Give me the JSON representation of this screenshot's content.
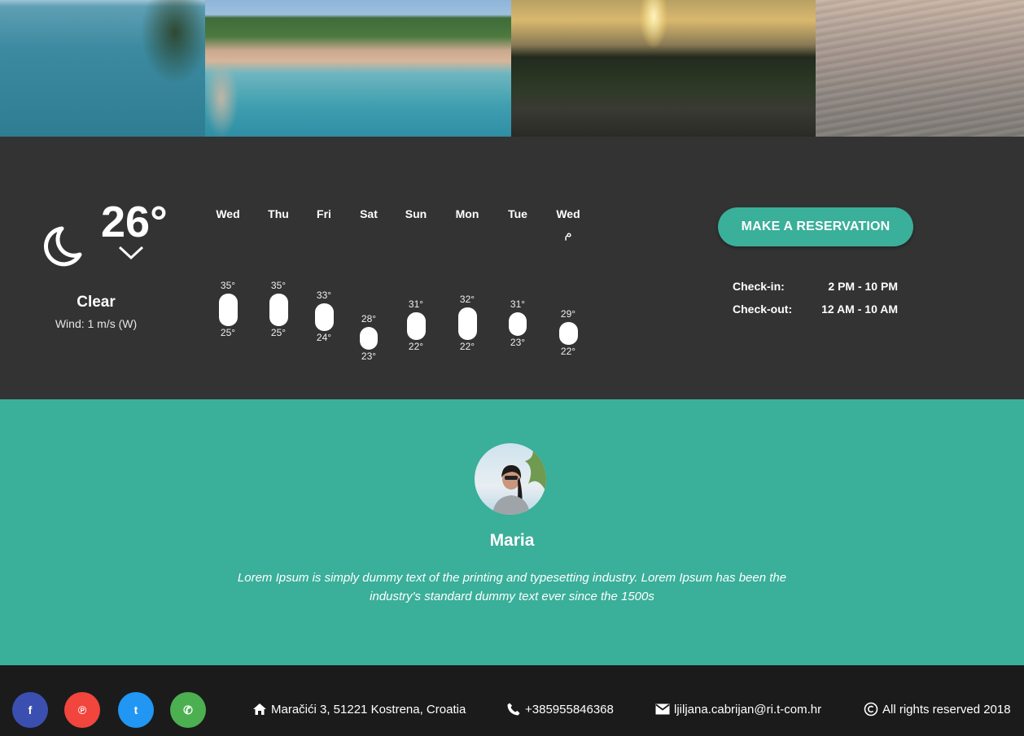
{
  "weather": {
    "current_temp": "26°",
    "condition": "Clear",
    "wind": "Wind: 1 m/s (W)",
    "icon": "moon-icon",
    "forecast": [
      {
        "day": "Wed",
        "high": "35°",
        "low": "25°",
        "high_val": 35,
        "low_val": 25
      },
      {
        "day": "Thu",
        "high": "35°",
        "low": "25°",
        "high_val": 35,
        "low_val": 25
      },
      {
        "day": "Fri",
        "high": "33°",
        "low": "24°",
        "high_val": 33,
        "low_val": 24
      },
      {
        "day": "Sat",
        "high": "28°",
        "low": "23°",
        "high_val": 28,
        "low_val": 23
      },
      {
        "day": "Sun",
        "high": "31°",
        "low": "22°",
        "high_val": 31,
        "low_val": 22
      },
      {
        "day": "Mon",
        "high": "32°",
        "low": "22°",
        "high_val": 32,
        "low_val": 22
      },
      {
        "day": "Tue",
        "high": "31°",
        "low": "23°",
        "high_val": 31,
        "low_val": 23
      },
      {
        "day": "Wed",
        "high": "29°",
        "low": "22°",
        "high_val": 29,
        "low_val": 22,
        "icon_glyph": "ﻡ"
      }
    ]
  },
  "reservation": {
    "button_label": "MAKE A RESERVATION",
    "checkin_label": "Check-in:",
    "checkin_value": "2 PM - 10 PM",
    "checkout_label": "Check-out:",
    "checkout_value": "12 AM - 10 AM"
  },
  "testimonial": {
    "name": "Maria",
    "text": "Lorem Ipsum is simply dummy text of the printing and typesetting industry. Lorem Ipsum has been the industry's standard dummy text ever since the 1500s"
  },
  "footer": {
    "social": [
      {
        "name": "facebook",
        "glyph": "f",
        "color": "#3b4fb0"
      },
      {
        "name": "pinterest",
        "glyph": "℗",
        "color": "#f1453d"
      },
      {
        "name": "twitter",
        "glyph": "t",
        "color": "#2196f3"
      },
      {
        "name": "whatsapp",
        "glyph": "✆",
        "color": "#4caf50"
      }
    ],
    "address": "Maračići 3, 51221 Kostrena, Croatia",
    "phone": "+385955846368",
    "email": "ljiljana.cabrijan@ri.t-com.hr",
    "copyright": "All rights reserved 2018"
  },
  "colors": {
    "accent": "#3aaf9a",
    "weather_bg": "#333333",
    "footer_bg": "#1b1b1b"
  }
}
